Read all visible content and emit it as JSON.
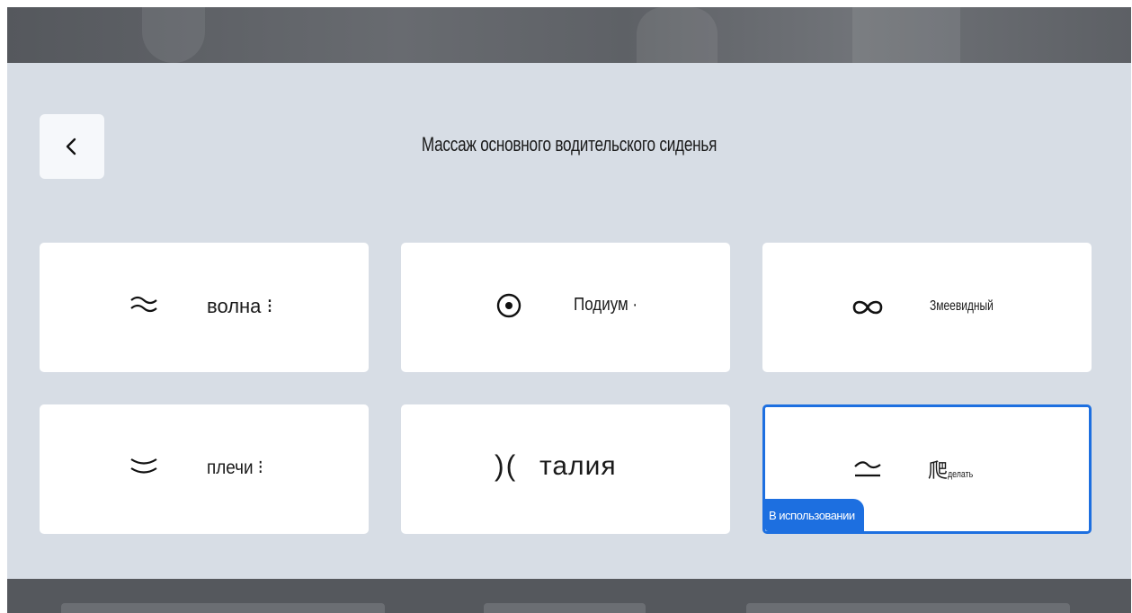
{
  "header": {
    "title": "Массаж основного водительского сиденья",
    "back_icon": "chevron-left-icon"
  },
  "modes": [
    {
      "label": "волна ⁝",
      "icon": "wave-icon"
    },
    {
      "label": "Подиум ·",
      "icon": "target-circle-icon"
    },
    {
      "label": "Змеевидный",
      "icon": "infinity-icon"
    },
    {
      "label": "плечи ⁝",
      "icon": "double-curve-icon"
    },
    {
      "label": "талия",
      "icon": "waist-brackets-icon",
      "glyph": ")("
    },
    {
      "label": "爬",
      "label_suffix": "делать",
      "icon": "stretch-icon",
      "badge": "В использовании",
      "selected": true
    }
  ],
  "colors": {
    "accent": "#1d6fe0",
    "panel": "#d7dde5",
    "card": "#ffffff"
  }
}
